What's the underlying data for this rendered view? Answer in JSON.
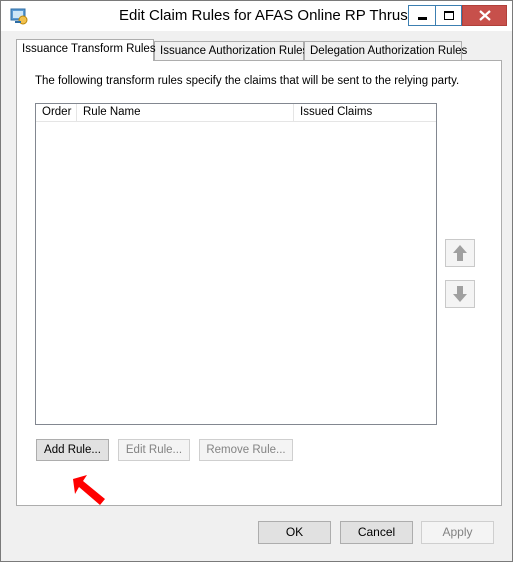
{
  "window": {
    "title": "Edit Claim Rules for AFAS Online RP Thrust",
    "icon": "adfs-app-icon",
    "controls": {
      "minimize": "minimize-icon",
      "maximize": "maximize-icon",
      "close": "close-icon"
    }
  },
  "tabs": [
    {
      "label": "Issuance Transform Rules",
      "active": true
    },
    {
      "label": "Issuance Authorization Rules",
      "active": false
    },
    {
      "label": "Delegation Authorization Rules",
      "active": false
    }
  ],
  "panel": {
    "description": "The following transform rules specify the claims that will be sent to the relying party.",
    "list": {
      "columns": [
        "Order",
        "Rule Name",
        "Issued Claims"
      ],
      "rows": []
    },
    "move_up_icon": "arrow-up-icon",
    "move_down_icon": "arrow-down-icon",
    "buttons": {
      "add": "Add Rule...",
      "edit": "Edit Rule...",
      "remove": "Remove Rule..."
    }
  },
  "dialog_buttons": {
    "ok": "OK",
    "cancel": "Cancel",
    "apply": "Apply"
  },
  "annotation": {
    "icon": "red-arrow-pointer-icon",
    "color": "#ff0000"
  }
}
